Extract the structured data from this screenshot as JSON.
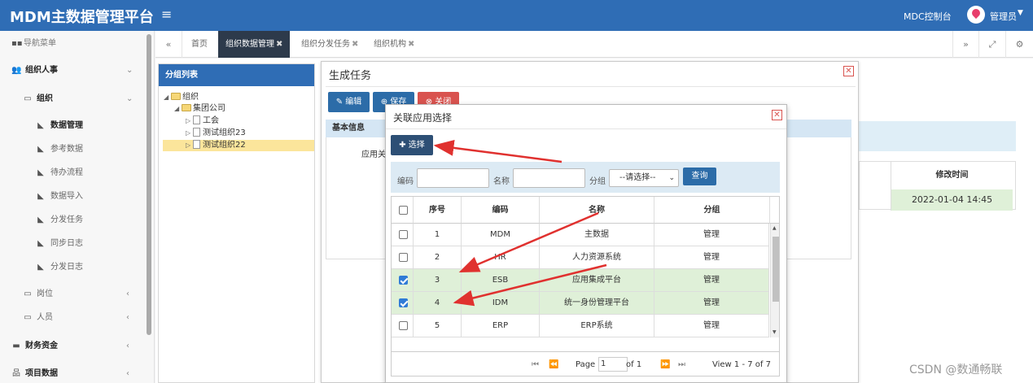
{
  "header": {
    "brand": "MDM主数据管理平台",
    "menu_icon": "≡",
    "console_link": "MDC控制台",
    "user": "管理员"
  },
  "sidebar": {
    "nav_title": "导航菜单",
    "items": [
      {
        "label": "组织人事"
      },
      {
        "label": "组织"
      },
      {
        "label": "数据管理"
      },
      {
        "label": "参考数据"
      },
      {
        "label": "待办流程"
      },
      {
        "label": "数据导入"
      },
      {
        "label": "分发任务"
      },
      {
        "label": "同步日志"
      },
      {
        "label": "分发日志"
      },
      {
        "label": "岗位"
      },
      {
        "label": "人员"
      },
      {
        "label": "财务资金"
      },
      {
        "label": "项目数据"
      }
    ]
  },
  "tabs": [
    {
      "label": "首页"
    },
    {
      "label": "组织数据管理",
      "active": true
    },
    {
      "label": "组织分发任务"
    },
    {
      "label": "组织机构"
    }
  ],
  "group_panel": {
    "title": "分组列表",
    "tree": [
      "组织",
      "集团公司",
      "工会",
      "测试组织23",
      "测试组织22"
    ]
  },
  "background_table": {
    "column": "修改时间",
    "row_value": "2022-01-04 14:45"
  },
  "task_dialog": {
    "title": "生成任务",
    "edit_btn": "编辑",
    "save_btn": "保存",
    "close_btn": "关闭",
    "section": "基本信息",
    "field_label": "应用关"
  },
  "select_dialog": {
    "title": "关联应用选择",
    "select_btn": "选择",
    "search": {
      "code_label": "编码",
      "name_label": "名称",
      "group_label": "分组",
      "group_value": "--请选择--",
      "query_btn": "查询"
    },
    "columns": [
      "序号",
      "编码",
      "名称",
      "分组"
    ],
    "rows": [
      {
        "no": "1",
        "code": "MDM",
        "name": "主数据",
        "group": "管理",
        "checked": false
      },
      {
        "no": "2",
        "code": "HR",
        "name": "人力资源系统",
        "group": "管理",
        "checked": false
      },
      {
        "no": "3",
        "code": "ESB",
        "name": "应用集成平台",
        "group": "管理",
        "checked": true
      },
      {
        "no": "4",
        "code": "IDM",
        "name": "统一身份管理平台",
        "group": "管理",
        "checked": true
      },
      {
        "no": "5",
        "code": "ERP",
        "name": "ERP系统",
        "group": "管理",
        "checked": false
      }
    ],
    "pager": {
      "page_label": "Page",
      "page_value": "1",
      "of_label": "of 1",
      "summary": "View 1 - 7 of 7"
    }
  },
  "annotation_color": "#e0312f",
  "watermark": "CSDN @数通畅联"
}
